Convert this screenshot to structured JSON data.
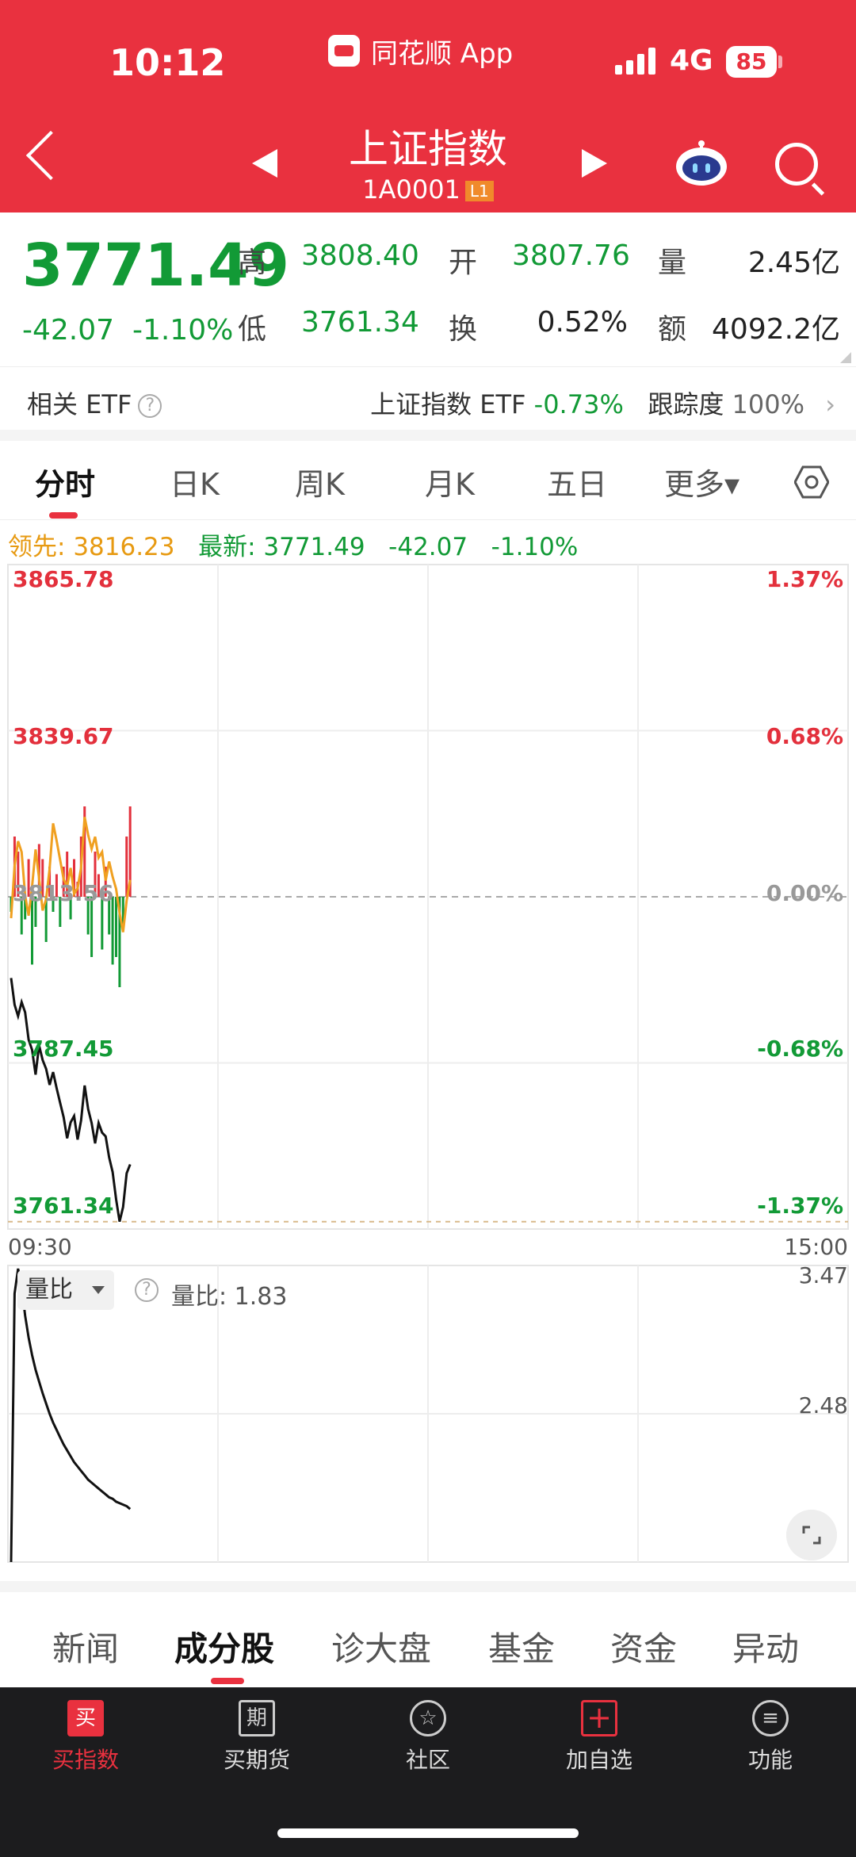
{
  "status": {
    "time": "10:12",
    "app": "同花顺 App",
    "network": "4G",
    "battery": "85"
  },
  "header": {
    "title": "上证指数",
    "code": "1A0001",
    "badge": "L1"
  },
  "quote": {
    "last": "3771.49",
    "change": "-42.07",
    "change_pct": "-1.10%",
    "high_label": "高",
    "high": "3808.40",
    "low_label": "低",
    "low": "3761.34",
    "open_label": "开",
    "open": "3807.76",
    "turnover_label": "换",
    "turnover": "0.52%",
    "volume_label": "量",
    "volume": "2.45亿",
    "amount_label": "额",
    "amount": "4092.2亿"
  },
  "etf": {
    "label": "相关 ETF",
    "name": "上证指数 ETF",
    "change": "-0.73%",
    "track_label": "跟踪度",
    "track": "100%"
  },
  "chart_tabs": [
    "分时",
    "日K",
    "周K",
    "月K",
    "五日",
    "更多▾"
  ],
  "info_line": {
    "lead_label": "领先:",
    "lead_value": "3816.23",
    "latest_label": "最新:",
    "latest_value": "3771.49",
    "change": "-42.07",
    "change_pct": "-1.10%"
  },
  "chart_data": [
    {
      "type": "line",
      "y_left_ticks": [
        "3865.78",
        "3839.67",
        "3813.56",
        "3787.45",
        "3761.34"
      ],
      "y_right_ticks": [
        "1.37%",
        "0.68%",
        "0.00%",
        "-0.68%",
        "-1.37%"
      ],
      "ylim": [
        3761.34,
        3865.78
      ],
      "x_ticks": [
        "09:30",
        "15:00"
      ],
      "series": [
        {
          "color": "#111111",
          "values": [
            3800.8,
            3796.6,
            3794.8,
            3797.0,
            3795.4,
            3791.1,
            3789.5,
            3785.6,
            3790.2,
            3787.9,
            3786.5,
            3784.0,
            3786.0,
            3783.5,
            3781.2,
            3778.9,
            3775.6,
            3778.1,
            3779.1,
            3775.4,
            3778.4,
            3783.9,
            3780.2,
            3778.0,
            3774.8,
            3778.0,
            3776.5,
            3775.9,
            3772.6,
            3770.3,
            3766.0,
            3762.5,
            3764.8,
            3770.1,
            3771.5
          ]
        },
        {
          "color": "#f0a020",
          "values": [
            3810.2,
            3818.4,
            3822.3,
            3820.6,
            3813.8,
            3810.6,
            3815.2,
            3821.0,
            3816.5,
            3811.4,
            3813.2,
            3818.0,
            3825.1,
            3822.4,
            3819.4,
            3816.3,
            3815.2,
            3818.1,
            3814.0,
            3814.9,
            3818.1,
            3826.1,
            3823.3,
            3821.1,
            3823.0,
            3819.7,
            3820.6,
            3816.1,
            3819.1,
            3816.7,
            3814.8,
            3811.0,
            3808.0,
            3813.0,
            3816.2
          ]
        },
        {
          "type": "bar",
          "name": "涨跌家数差",
          "values": [
            -2,
            8,
            6,
            -5,
            -3,
            5,
            -9,
            -4,
            7,
            5,
            -6,
            4,
            -2,
            3,
            -4,
            4,
            6,
            -3,
            5,
            2,
            8,
            12,
            -5,
            -8,
            6,
            3,
            -7,
            4,
            -5,
            -9,
            -8,
            -12,
            -4,
            8,
            12
          ]
        }
      ]
    },
    {
      "type": "line",
      "title": "量比",
      "value_label": "量比: 1.83",
      "y_ticks": [
        "3.47",
        "2.48"
      ],
      "values": [
        0.2,
        3.3,
        3.47,
        3.35,
        3.15,
        3.0,
        2.88,
        2.78,
        2.7,
        2.62,
        2.55,
        2.48,
        2.42,
        2.37,
        2.32,
        2.27,
        2.23,
        2.19,
        2.15,
        2.12,
        2.09,
        2.06,
        2.03,
        2.01,
        1.99,
        1.97,
        1.95,
        1.93,
        1.91,
        1.9,
        1.88,
        1.87,
        1.86,
        1.85,
        1.83
      ]
    }
  ],
  "news_tabs": [
    "新闻",
    "成分股",
    "诊大盘",
    "基金",
    "资金",
    "异动"
  ],
  "bottom_bar": [
    {
      "icon": "买",
      "label": "买指数"
    },
    {
      "icon": "期",
      "label": "买期货"
    },
    {
      "icon": "☆",
      "label": "社区"
    },
    {
      "icon": "+",
      "label": "加自选"
    },
    {
      "icon": "≡",
      "label": "功能"
    }
  ],
  "colors": {
    "brand": "#e9313f",
    "up": "#e3303c",
    "down": "#129a36",
    "lead": "#f0a020"
  }
}
